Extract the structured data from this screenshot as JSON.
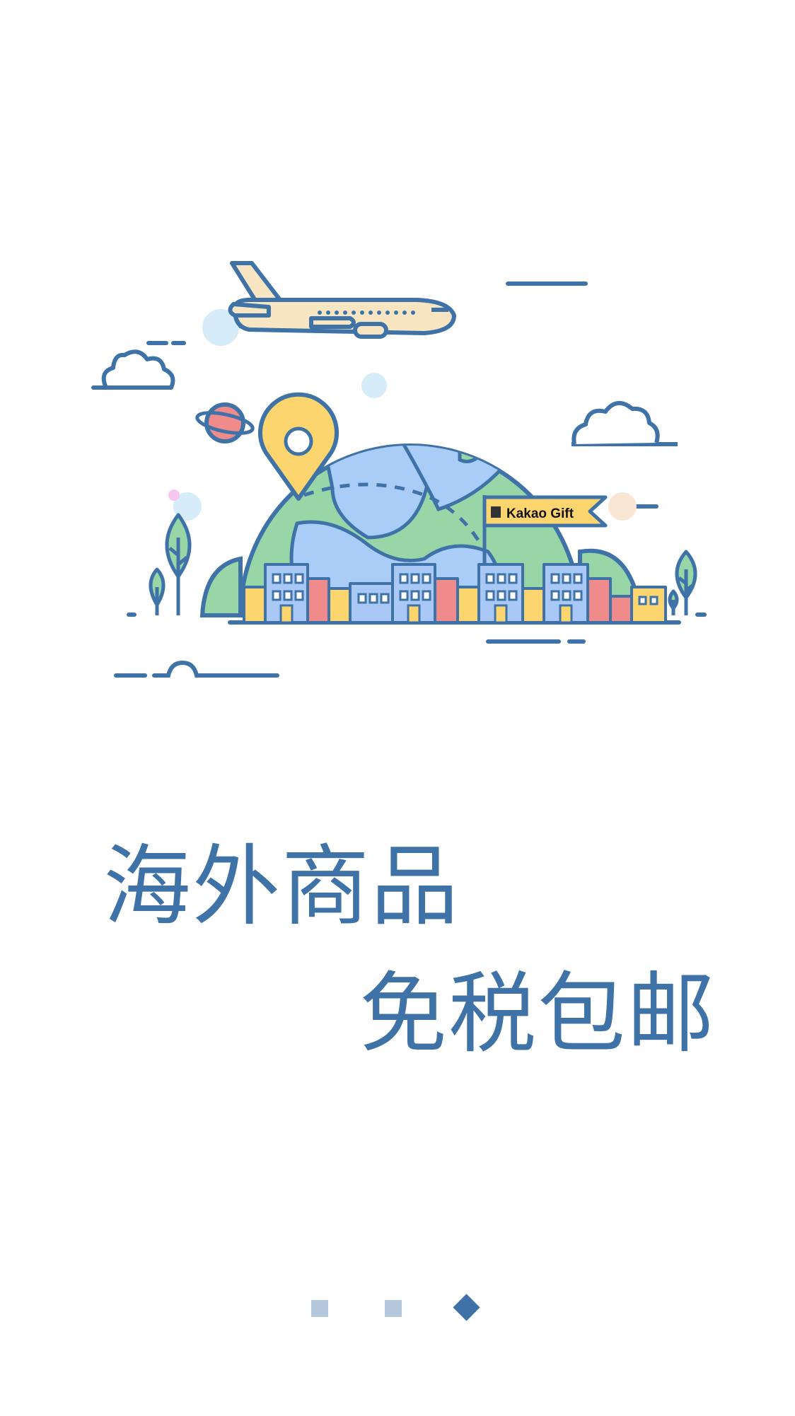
{
  "onboarding": {
    "headline_line1": "海外商品",
    "headline_line2": "免税包邮",
    "illustration": {
      "flag_label": "Kakao Gift",
      "icons": [
        "airplane-icon",
        "globe-icon",
        "location-pin-icon",
        "planet-icon",
        "cloud-icon",
        "tree-icon",
        "building-icon",
        "gift-flag-icon"
      ]
    },
    "pager": {
      "total_pages": 3,
      "current_page": 3
    }
  },
  "colors": {
    "primary_blue": "#3f73a8",
    "inactive_dot": "#b5c8dc",
    "globe_land": "#98d6a8",
    "globe_sea": "#a9cdf7",
    "pin_yellow": "#fdd56e",
    "building_pink": "#f08b8c",
    "building_blue": "#a9c8f5",
    "plane_cream": "#f8e6c2"
  }
}
